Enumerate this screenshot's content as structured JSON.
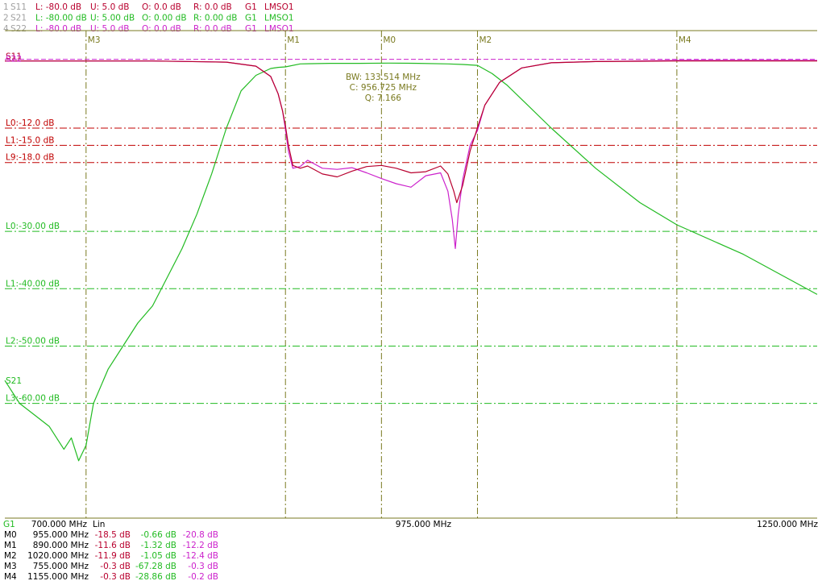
{
  "header": {
    "rows": [
      {
        "idx": "1",
        "param": "S11",
        "L": "L: -80.0 dB",
        "U": "U:  5.0 dB",
        "O": "O:  0.0 dB",
        "R": "R:  0.0 dB",
        "G": "G1",
        "name": "LMSO1",
        "color": "#b8002e"
      },
      {
        "idx": "2",
        "param": "S21",
        "L": "L: -80.00 dB",
        "U": "U:  5.00 dB",
        "O": "O:  0.00 dB",
        "R": "R:  0.00 dB",
        "G": "G1",
        "name": "LMSO1",
        "color": "#22bb22"
      },
      {
        "idx": "4",
        "param": "S22",
        "L": "L: -80.0 dB",
        "U": "U:  5.0 dB",
        "O": "O:  0.0 dB",
        "R": "R:  0.0 dB",
        "G": "G1",
        "name": "LMSO1",
        "color": "#cc22cc"
      }
    ],
    "index_color": "#a0a0a0"
  },
  "chart_data": {
    "type": "line",
    "x_unit": "MHz",
    "xlim": [
      700,
      1250
    ],
    "ylim_db": [
      -80,
      5
    ],
    "grid_color": "#7a7a20",
    "trace_tags": [
      "S11",
      "S22",
      "S21"
    ],
    "markers": [
      {
        "label": "M0",
        "freq": 955.0,
        "s11": "-18.5 dB",
        "s21": "-0.66 dB",
        "s22": "-20.8 dB"
      },
      {
        "label": "M1",
        "freq": 890.0,
        "s11": "-11.6 dB",
        "s21": "-1.32 dB",
        "s22": "-12.2 dB"
      },
      {
        "label": "M2",
        "freq": 1020.0,
        "s11": "-11.9 dB",
        "s21": "-1.05 dB",
        "s22": "-12.4 dB"
      },
      {
        "label": "M3",
        "freq": 755.0,
        "s11": "-0.3 dB",
        "s21": "-67.28 dB",
        "s22": "-0.3 dB"
      },
      {
        "label": "M4",
        "freq": 1155.0,
        "s11": "-0.3 dB",
        "s21": "-28.86 dB",
        "s22": "-0.2 dB"
      }
    ],
    "limit_lines": [
      {
        "label": "L0:-12.0 dB",
        "db": -12,
        "color": "#c00000"
      },
      {
        "label": "L1:-15.0 dB",
        "db": -15,
        "color": "#c00000"
      },
      {
        "label": "L9:-18.0 dB",
        "db": -18,
        "color": "#c00000"
      },
      {
        "label": "L0:-30.00 dB",
        "db": -30,
        "color": "#22bb22"
      },
      {
        "label": "L1:-40.00 dB",
        "db": -40,
        "color": "#22bb22"
      },
      {
        "label": "L2:-50.00 dB",
        "db": -50,
        "color": "#22bb22"
      },
      {
        "label": "L3:-60.00 dB",
        "db": -60,
        "color": "#22bb22"
      }
    ],
    "reference_line": {
      "db": 0,
      "color": "#cc22cc"
    },
    "annotation": [
      "BW: 133.514 MHz",
      "C: 956.725 MHz",
      "Q: 7.166"
    ],
    "annotation_color": "#7a7a20",
    "series": [
      {
        "name": "S11",
        "color": "#b8002e",
        "x": [
          700,
          800,
          850,
          870,
          880,
          885,
          888,
          890,
          892,
          895,
          900,
          905,
          915,
          925,
          935,
          945,
          955,
          965,
          975,
          985,
          995,
          1000,
          1004,
          1006,
          1010,
          1015,
          1020,
          1025,
          1035,
          1050,
          1070,
          1100,
          1155,
          1200,
          1250
        ],
        "y": [
          -0.3,
          -0.3,
          -0.5,
          -1.2,
          -3,
          -6,
          -9,
          -11.6,
          -15,
          -18.5,
          -19,
          -18.6,
          -20,
          -20.5,
          -19.5,
          -18.7,
          -18.5,
          -19,
          -19.8,
          -19.6,
          -18.6,
          -20,
          -23,
          -25,
          -22,
          -16,
          -11.9,
          -8,
          -4,
          -1.5,
          -0.6,
          -0.4,
          -0.3,
          -0.3,
          -0.3
        ]
      },
      {
        "name": "S22",
        "color": "#cc22cc",
        "x": [
          700,
          800,
          850,
          870,
          880,
          885,
          888,
          890,
          892,
          895,
          900,
          905,
          915,
          925,
          935,
          945,
          955,
          965,
          975,
          985,
          995,
          1000,
          1003,
          1005,
          1007,
          1010,
          1015,
          1020,
          1025,
          1035,
          1050,
          1070,
          1100,
          1155,
          1200,
          1250
        ],
        "y": [
          -0.3,
          -0.3,
          -0.5,
          -1.2,
          -3,
          -6,
          -9,
          -12.2,
          -16,
          -19,
          -18.7,
          -17.6,
          -19,
          -19.2,
          -18.9,
          -19.8,
          -20.8,
          -21.7,
          -22.3,
          -20.3,
          -19.8,
          -23,
          -28,
          -33,
          -27,
          -21,
          -15,
          -12.4,
          -8,
          -4,
          -1.5,
          -0.6,
          -0.4,
          -0.2,
          -0.2,
          -0.2
        ]
      },
      {
        "name": "S21",
        "color": "#22bb22",
        "x": [
          700,
          710,
          720,
          730,
          740,
          745,
          750,
          755,
          760,
          770,
          780,
          790,
          800,
          810,
          820,
          830,
          840,
          850,
          860,
          870,
          880,
          885,
          890,
          900,
          920,
          940,
          960,
          980,
          1000,
          1010,
          1020,
          1030,
          1040,
          1050,
          1070,
          1100,
          1130,
          1155,
          1200,
          1250
        ],
        "y": [
          -56,
          -60,
          -62,
          -64,
          -68,
          -66,
          -70,
          -67.3,
          -60,
          -54,
          -50,
          -46,
          -43,
          -38,
          -33,
          -27,
          -20,
          -12,
          -5.5,
          -2.8,
          -1.6,
          -1.4,
          -1.32,
          -0.8,
          -0.7,
          -0.7,
          -0.66,
          -0.7,
          -0.8,
          -0.9,
          -1.05,
          -2.5,
          -4.5,
          -7,
          -12,
          -19,
          -25,
          -28.86,
          -34,
          -41
        ]
      }
    ]
  },
  "xaxis": {
    "group": "G1",
    "start": "700.000 MHz",
    "scale": "Lin",
    "center": "975.000 MHz",
    "stop": "1250.000 MHz"
  },
  "marker_table": {
    "rows": [
      {
        "m": "M0",
        "f": "955.000 MHz",
        "a": "-18.5 dB",
        "b": "-0.66 dB",
        "c": "-20.8 dB"
      },
      {
        "m": "M1",
        "f": "890.000 MHz",
        "a": "-11.6 dB",
        "b": "-1.32 dB",
        "c": "-12.2 dB"
      },
      {
        "m": "M2",
        "f": "1020.000 MHz",
        "a": "-11.9 dB",
        "b": "-1.05 dB",
        "c": "-12.4 dB"
      },
      {
        "m": "M3",
        "f": "755.000 MHz",
        "a": "-0.3 dB",
        "b": "-67.28 dB",
        "c": "-0.3 dB"
      },
      {
        "m": "M4",
        "f": "1155.000 MHz",
        "a": "-0.3 dB",
        "b": "-28.86 dB",
        "c": "-0.2 dB"
      }
    ]
  }
}
